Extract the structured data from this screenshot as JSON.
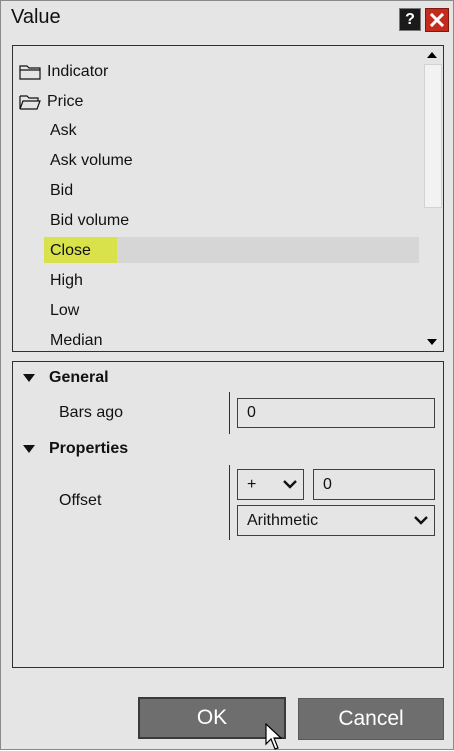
{
  "window": {
    "title": "Value",
    "help_label": "?"
  },
  "list": {
    "folders": [
      {
        "label": "Indicator",
        "icon": "folder-closed-icon"
      },
      {
        "label": "Price",
        "icon": "folder-open-icon"
      }
    ],
    "items": [
      "Ask",
      "Ask volume",
      "Bid",
      "Bid volume",
      "Close",
      "High",
      "Low",
      "Median"
    ],
    "selected": "Close",
    "highlight_color": "#d9e24a"
  },
  "properties": {
    "general": {
      "header": "General",
      "bars_ago_label": "Bars ago",
      "bars_ago_value": "0"
    },
    "props": {
      "header": "Properties",
      "offset_label": "Offset",
      "sign_value": "+",
      "offset_value": "0",
      "type_value": "Arithmetic"
    }
  },
  "buttons": {
    "ok": "OK",
    "cancel": "Cancel"
  }
}
